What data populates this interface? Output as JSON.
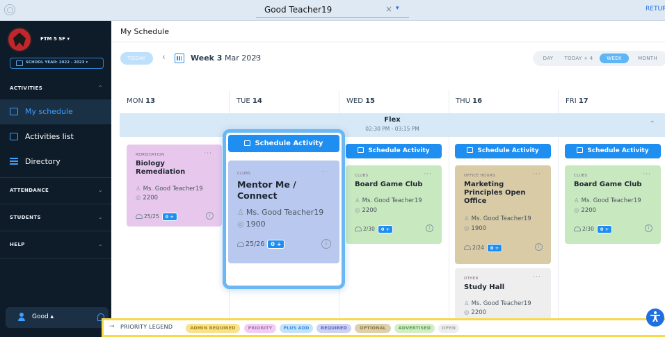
{
  "topbar": {
    "teacher_select": "Good Teacher19",
    "clear_glyph": "×",
    "caret_glyph": "▾",
    "return_label": "RETURI"
  },
  "sidebar": {
    "school_name": "FTM 5 SF ▾",
    "school_year": "SCHOOL YEAR: 2022 - 2023 ▾",
    "sections": {
      "activities": "ACTIVITIES",
      "attendance": "ATTENDANCE",
      "students": "STUDENTS",
      "help": "HELP"
    },
    "items": [
      {
        "label": "My schedule",
        "icon": "calendar-icon",
        "active": true
      },
      {
        "label": "Activities list",
        "icon": "calendar-check-icon"
      },
      {
        "label": "Directory",
        "icon": "list-icon"
      }
    ],
    "user_name": "Good ▴"
  },
  "header": {
    "title": "My Schedule",
    "today": "TODAY",
    "prev": "‹",
    "next": "›",
    "week_bold": "Week 3",
    "week_rest": " Mar 2023",
    "views": [
      "DAY",
      "TODAY + 4",
      "WEEK",
      "MONTH"
    ],
    "active_view": "WEEK"
  },
  "days": [
    {
      "dow": "MON",
      "num": "13"
    },
    {
      "dow": "TUE",
      "num": "14"
    },
    {
      "dow": "WED",
      "num": "15"
    },
    {
      "dow": "THU",
      "num": "16"
    },
    {
      "dow": "FRI",
      "num": "17"
    }
  ],
  "flex": {
    "title": "Flex",
    "time": "02:30 PM - 03:15 PM",
    "chevron": "⌃"
  },
  "schedule_label": "Schedule Activity",
  "cards": {
    "mon": {
      "category": "REMEDIATION",
      "title": "Biology Remediation",
      "teacher": "Ms. Good Teacher19",
      "room": "2200",
      "capacity": "25/25",
      "plus": "0 +",
      "color": "#e7c8ec"
    },
    "tue": {
      "category": "CLUBS",
      "title": "Mentor Me / Connect",
      "teacher": "Ms. Good Teacher19",
      "room": "1900",
      "capacity": "25/26",
      "plus": "0 +",
      "color": "#b9c8ef"
    },
    "wed": {
      "category": "CLUBS",
      "title": "Board Game Club",
      "teacher": "Ms. Good Teacher19",
      "room": "2200",
      "capacity": "2/30",
      "plus": "0 +",
      "color": "#c8e8bf"
    },
    "thu": {
      "category": "OFFICE HOURS",
      "title": "Marketing Principles Open Office",
      "teacher": "Ms. Good Teacher19",
      "room": "1900",
      "capacity": "2/24",
      "plus": "0 +",
      "color": "#d8cba6"
    },
    "thu2": {
      "category": "OTHER",
      "title": "Study Hall",
      "teacher": "Ms. Good Teacher19",
      "room": "2200",
      "color": "#eeeeee"
    },
    "fri": {
      "category": "CLUBS",
      "title": "Board Game Club",
      "teacher": "Ms. Good Teacher19",
      "room": "2200",
      "capacity": "2/30",
      "plus": "0 +",
      "color": "#c8e8bf"
    }
  },
  "legend": {
    "arrow": "→",
    "label": "PRIORITY LEGEND",
    "pills": [
      {
        "label": "ADMIN REQUIRED",
        "bg": "#f8e28a",
        "fg": "#a4841a"
      },
      {
        "label": "PRIORITY",
        "bg": "#f1cdf3",
        "fg": "#a872b2"
      },
      {
        "label": "PLUS ADD",
        "bg": "#c4e2fa",
        "fg": "#3a8ed8"
      },
      {
        "label": "REQUIRED",
        "bg": "#cdd2f4",
        "fg": "#5864b8"
      },
      {
        "label": "OPTIONAL",
        "bg": "#ddd1ad",
        "fg": "#8a7540"
      },
      {
        "label": "ADVERTISED",
        "bg": "#d3eec7",
        "fg": "#5e9a50"
      },
      {
        "label": "OPEN",
        "bg": "#eeeeee",
        "fg": "#a8a8a8"
      }
    ]
  },
  "info_glyph": "i",
  "more_glyph": "···"
}
